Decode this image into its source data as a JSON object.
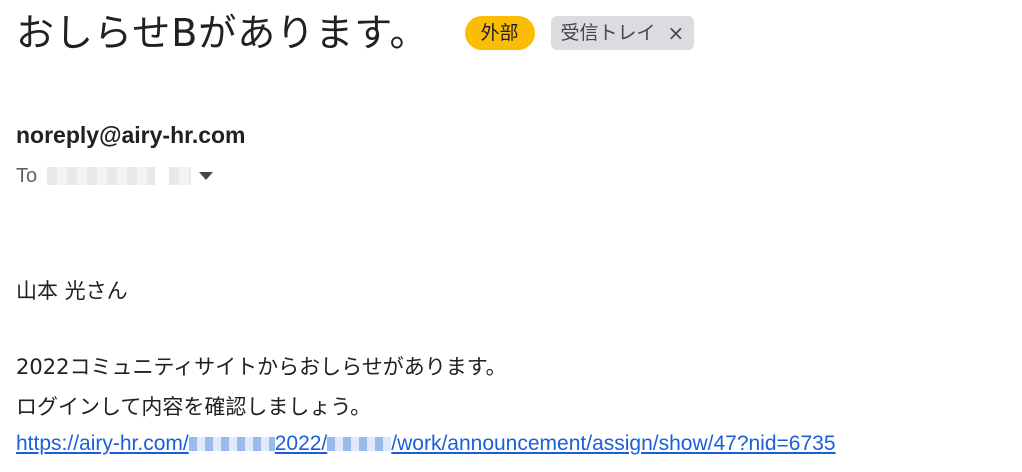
{
  "email": {
    "subject": "おしらせBがあります。",
    "labels": {
      "external": "外部",
      "inbox": "受信トレイ",
      "remove": "×"
    },
    "sender": "noreply@airy-hr.com",
    "to_prefix": "To",
    "greeting": "山本 光さん",
    "body_line1": "2022コミュニティサイトからおしらせがあります。",
    "body_line2": "ログインして内容を確認しましょう。",
    "link": {
      "part1": "https://airy-hr.com/",
      "part2": "2022/",
      "part3": "/work/announcement/assign/show/47?nid=6735"
    }
  },
  "icons": {
    "recipient_details": "chevron-down-icon",
    "remove_label": "close-icon"
  },
  "colors": {
    "external_label_bg": "#fbbc04",
    "inbox_label_bg": "#dadce0",
    "link": "#1a5fd9"
  }
}
